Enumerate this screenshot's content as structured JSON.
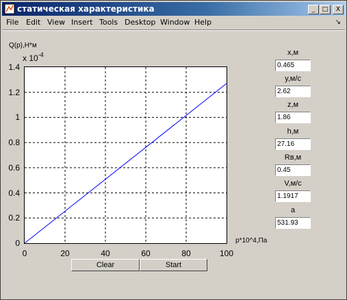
{
  "window": {
    "title": "статическая характеристика",
    "minimize": "_",
    "maximize": "□",
    "close": "X"
  },
  "menu": [
    "File",
    "Edit",
    "View",
    "Insert",
    "Tools",
    "Desktop",
    "Window",
    "Help"
  ],
  "menu_arrow": "↘",
  "plot": {
    "ylabel": "Q(p),H*м",
    "exponent_base": "x 10",
    "exponent_power": "-4",
    "xlabel": "p*10^4,Па",
    "yticks": [
      "0",
      "0.2",
      "0.4",
      "0.6",
      "0.8",
      "1",
      "1.2",
      "1.4"
    ],
    "xticks": [
      "0",
      "20",
      "40",
      "60",
      "80",
      "100"
    ]
  },
  "chart_data": {
    "type": "line",
    "xlim": [
      0,
      100
    ],
    "ylim": [
      0,
      1.4
    ],
    "grid": true,
    "line_color": "#0000ff",
    "series": [
      {
        "x": [
          0,
          100
        ],
        "y": [
          0,
          1.27
        ]
      }
    ]
  },
  "buttons": {
    "clear": "Clear",
    "start": "Start"
  },
  "fields": [
    {
      "label": "x,м",
      "value": "0.465"
    },
    {
      "label": "y,м/с",
      "value": "2.62"
    },
    {
      "label": "z,м",
      "value": "1.86"
    },
    {
      "label": "h,м",
      "value": "27.16"
    },
    {
      "label": "Rв,м",
      "value": "0.45"
    },
    {
      "label": "V,м/с",
      "value": "1.1917"
    },
    {
      "label": "a",
      "value": "531.93"
    }
  ]
}
